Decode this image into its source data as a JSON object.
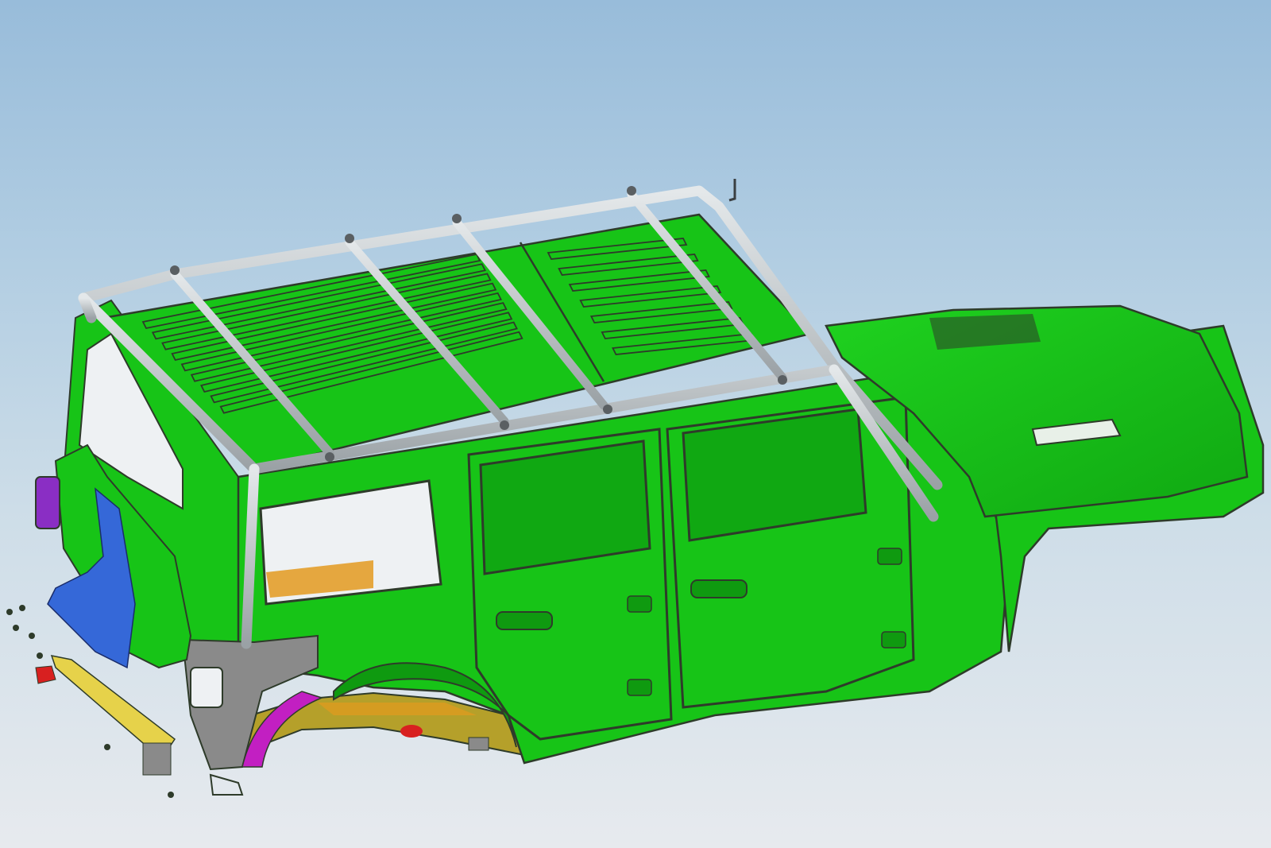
{
  "viewport": {
    "background_top": "#98bcda",
    "background_bottom": "#e7eaee"
  },
  "model": {
    "body_color": "#17c417",
    "body_shade": "#0f9a10",
    "edge_color": "#2e3b2a",
    "rack_color": "#c4c9cc",
    "frame_gray": "#8a8a8a",
    "orange_part": "#e39a1e",
    "purple_part": "#8a2ec4",
    "blue_part": "#3568d8",
    "red_part": "#d82020",
    "yellow_part": "#e6d24a",
    "magenta_part": "#c21fc2"
  }
}
